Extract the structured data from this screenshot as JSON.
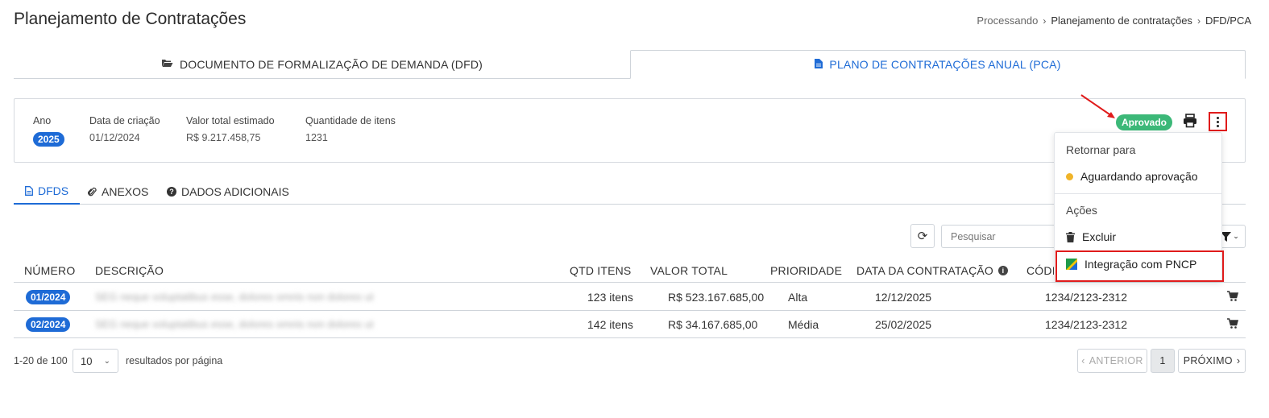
{
  "page": {
    "title": "Planejamento de Contratações",
    "breadcrumb": [
      "Processando",
      "Planejamento de contratações",
      "DFD/PCA"
    ]
  },
  "main_tabs": [
    {
      "label": "DOCUMENTO DE FORMALIZAÇÃO DE DEMANDA (DFD)",
      "icon": "folder-open-icon",
      "active": false
    },
    {
      "label": "PLANO DE CONTRATAÇÕES ANUAL (PCA)",
      "icon": "file-icon",
      "active": true
    }
  ],
  "summary": {
    "year_label": "Ano",
    "year_value": "2025",
    "created_label": "Data de criação",
    "created_value": "01/12/2024",
    "total_label": "Valor total estimado",
    "total_value": "R$ 9.217.458,75",
    "qty_label": "Quantidade de itens",
    "qty_value": "1231",
    "status": "Aprovado"
  },
  "sub_tabs": [
    {
      "label": "DFDS",
      "icon": "file-icon",
      "active": true
    },
    {
      "label": "ANEXOS",
      "icon": "paperclip-icon",
      "active": false
    },
    {
      "label": "DADOS ADICIONAIS",
      "icon": "question-circle-icon",
      "active": false
    }
  ],
  "toolbar": {
    "search_placeholder": "Pesquisar"
  },
  "table": {
    "columns": [
      "NÚMERO",
      "DESCRIÇÃO",
      "QTD ITENS",
      "VALOR TOTAL",
      "PRIORIDADE",
      "DATA DA CONTRATAÇÃO",
      "CÓDI"
    ],
    "rows": [
      {
        "numero": "01/2024",
        "descricao": "SEG neque voluptatibus esse, dolores omnis non dolores ut",
        "qtd": "123 itens",
        "valor": "R$ 523.167.685,00",
        "prioridade": "Alta",
        "data": "12/12/2025",
        "codigo": "1234/2123-2312"
      },
      {
        "numero": "02/2024",
        "descricao": "SEG neque voluptatibus esse, dolores omnis non dolores ut",
        "qtd": "142 itens",
        "valor": "R$ 34.167.685,00",
        "prioridade": "Média",
        "data": "25/02/2025",
        "codigo": "1234/2123-2312"
      }
    ]
  },
  "pagination": {
    "info": "1-20 de 100",
    "page_size": "10",
    "per_page_label": "resultados por página",
    "prev_label": "ANTERIOR",
    "current_page": "1",
    "next_label": "PRÓXIMO"
  },
  "menu": {
    "return_header": "Retornar para",
    "return_item": "Aguardando aprovação",
    "actions_header": "Ações",
    "delete_item": "Excluir",
    "pncp_item": "Integração com PNCP"
  },
  "colors": {
    "primary": "#1e6bd6",
    "success": "#3cb878",
    "highlight": "#e01b1b",
    "pending": "#f0b429"
  }
}
